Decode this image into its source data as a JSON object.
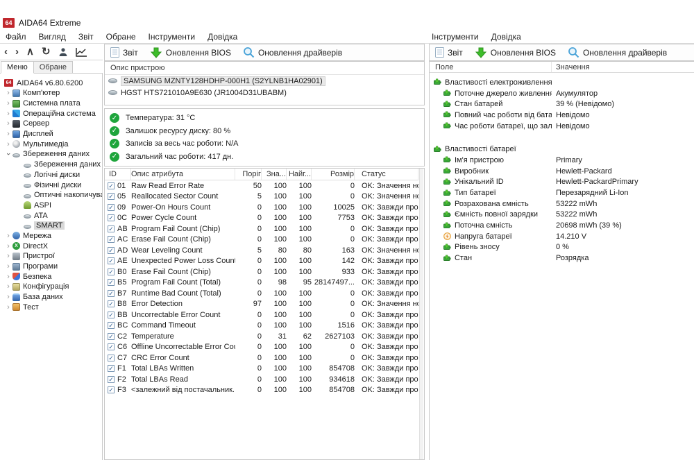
{
  "window": {
    "title": "AIDA64 Extreme",
    "logo": "64"
  },
  "menus": {
    "left": [
      "Файл",
      "Вигляд",
      "Звіт",
      "Обране",
      "Інструменти",
      "Довідка"
    ],
    "right": [
      "Інструменти",
      "Довідка"
    ]
  },
  "nav_icons": [
    "back-arrow",
    "forward-arrow",
    "up-arrow",
    "refresh",
    "user",
    "chart"
  ],
  "toolbar": {
    "report_label": "Звіт",
    "bios_label": "Оновлення BIOS",
    "drivers_label": "Оновлення драйверів"
  },
  "sidebar": {
    "tabs": [
      {
        "label": "Меню",
        "active": true
      },
      {
        "label": "Обране",
        "active": false
      }
    ],
    "root_label": "AIDA64 v6.80.6200",
    "items": [
      {
        "label": "Комп'ютер",
        "icon": "computer",
        "chevron": "collapsed",
        "sub": false,
        "selected": false
      },
      {
        "label": "Системна плата",
        "icon": "motherboard",
        "chevron": "collapsed",
        "sub": false,
        "selected": false
      },
      {
        "label": "Операційна система",
        "icon": "os",
        "chevron": "collapsed",
        "sub": false,
        "selected": false
      },
      {
        "label": "Сервер",
        "icon": "server",
        "chevron": "collapsed",
        "sub": false,
        "selected": false
      },
      {
        "label": "Дисплей",
        "icon": "display",
        "chevron": "collapsed",
        "sub": false,
        "selected": false
      },
      {
        "label": "Мультимедіа",
        "icon": "multimedia",
        "chevron": "collapsed",
        "sub": false,
        "selected": false
      },
      {
        "label": "Збереження даних",
        "icon": "disk",
        "chevron": "expanded",
        "sub": false,
        "selected": false
      },
      {
        "label": "Збереження даних Wi",
        "icon": "disk",
        "chevron": null,
        "sub": true,
        "selected": false
      },
      {
        "label": "Логічні диски",
        "icon": "disk",
        "chevron": null,
        "sub": true,
        "selected": false
      },
      {
        "label": "Фізичні диски",
        "icon": "disk",
        "chevron": null,
        "sub": true,
        "selected": false
      },
      {
        "label": "Оптичні накопичувачі",
        "icon": "disk",
        "chevron": null,
        "sub": true,
        "selected": false
      },
      {
        "label": "ASPI",
        "icon": "aspi",
        "chevron": null,
        "sub": true,
        "selected": false
      },
      {
        "label": "ATA",
        "icon": "disk",
        "chevron": null,
        "sub": true,
        "selected": false
      },
      {
        "label": "SMART",
        "icon": "disk",
        "chevron": null,
        "sub": true,
        "selected": true
      },
      {
        "label": "Мережа",
        "icon": "network",
        "chevron": "collapsed",
        "sub": false,
        "selected": false
      },
      {
        "label": "DirectX",
        "icon": "directx",
        "chevron": "collapsed",
        "sub": false,
        "selected": false
      },
      {
        "label": "Пристрої",
        "icon": "devices",
        "chevron": "collapsed",
        "sub": false,
        "selected": false
      },
      {
        "label": "Програми",
        "icon": "programs",
        "chevron": "collapsed",
        "sub": false,
        "selected": false
      },
      {
        "label": "Безпека",
        "icon": "security",
        "chevron": "collapsed",
        "sub": false,
        "selected": false
      },
      {
        "label": "Конфігурація",
        "icon": "config",
        "chevron": "collapsed",
        "sub": false,
        "selected": false
      },
      {
        "label": "База даних",
        "icon": "database",
        "chevron": "collapsed",
        "sub": false,
        "selected": false
      },
      {
        "label": "Тест",
        "icon": "test",
        "chevron": "collapsed",
        "sub": false,
        "selected": false
      }
    ]
  },
  "devices": {
    "header": "Опис пристрою",
    "rows": [
      {
        "label": "SAMSUNG MZNTY128HDHP-000H1 (S2YLNB1HA02901)",
        "selected": true
      },
      {
        "label": "HGST HTS721010A9E630 (JR1004D31UBABM)",
        "selected": false
      }
    ]
  },
  "status_items": [
    "Температура: 31 °C",
    "Залишок ресурсу диску: 80 %",
    "Записів за весь час роботи: N/A",
    "Загальний час роботи: 417 дн."
  ],
  "smart_table": {
    "columns": [
      "ID",
      "Опис атрибута",
      "Поріг",
      "Зна...",
      "Найг...",
      "Розмір",
      "Статус"
    ],
    "rows": [
      [
        "01",
        "Raw Read Error Rate",
        "50",
        "100",
        "100",
        "0",
        "OK: Значення норм..."
      ],
      [
        "05",
        "Reallocated Sector Count",
        "5",
        "100",
        "100",
        "0",
        "OK: Значення норм..."
      ],
      [
        "09",
        "Power-On Hours Count",
        "0",
        "100",
        "100",
        "10025",
        "OK: Завжди пройде..."
      ],
      [
        "0C",
        "Power Cycle Count",
        "0",
        "100",
        "100",
        "7753",
        "OK: Завжди пройде..."
      ],
      [
        "AB",
        "Program Fail Count (Chip)",
        "0",
        "100",
        "100",
        "0",
        "OK: Завжди пройде..."
      ],
      [
        "AC",
        "Erase Fail Count (Chip)",
        "0",
        "100",
        "100",
        "0",
        "OK: Завжди пройде..."
      ],
      [
        "AD",
        "Wear Leveling Count",
        "5",
        "80",
        "80",
        "163",
        "OK: Значення норм..."
      ],
      [
        "AE",
        "Unexpected Power Loss Count",
        "0",
        "100",
        "100",
        "142",
        "OK: Завжди пройде..."
      ],
      [
        "B0",
        "Erase Fail Count (Chip)",
        "0",
        "100",
        "100",
        "933",
        "OK: Завжди пройде..."
      ],
      [
        "B5",
        "Program Fail Count (Total)",
        "0",
        "98",
        "95",
        "28147497...",
        "OK: Завжди пройде..."
      ],
      [
        "B7",
        "Runtime Bad Count (Total)",
        "0",
        "100",
        "100",
        "0",
        "OK: Завжди пройде..."
      ],
      [
        "B8",
        "Error Detection",
        "97",
        "100",
        "100",
        "0",
        "OK: Значення норм..."
      ],
      [
        "BB",
        "Uncorrectable Error Count",
        "0",
        "100",
        "100",
        "0",
        "OK: Завжди пройде..."
      ],
      [
        "BC",
        "Command Timeout",
        "0",
        "100",
        "100",
        "1516",
        "OK: Завжди пройде..."
      ],
      [
        "C2",
        "Temperature",
        "0",
        "31",
        "62",
        "2627103",
        "OK: Завжди пройде..."
      ],
      [
        "C6",
        "Offline Uncorrectable Error Cou...",
        "0",
        "100",
        "100",
        "0",
        "OK: Завжди пройде..."
      ],
      [
        "C7",
        "CRC Error Count",
        "0",
        "100",
        "100",
        "0",
        "OK: Завжди пройде..."
      ],
      [
        "F1",
        "Total LBAs Written",
        "0",
        "100",
        "100",
        "854708",
        "OK: Завжди пройде..."
      ],
      [
        "F2",
        "Total LBAs Read",
        "0",
        "100",
        "100",
        "934618",
        "OK: Завжди пройде..."
      ],
      [
        "F3",
        "<залежний від постачальник...",
        "0",
        "100",
        "100",
        "854708",
        "OK: Завжди пройде..."
      ]
    ]
  },
  "battery_panel": {
    "columns": {
      "field": "Поле",
      "value": "Значення"
    },
    "sections": [
      {
        "title": "Властивості електроживлення",
        "rows": [
          {
            "field": "Поточне джерело живлення",
            "value": "Акумулятор",
            "icon": "battery"
          },
          {
            "field": "Стан батарей",
            "value": "39 % (Невідомо)",
            "icon": "battery"
          },
          {
            "field": "Повний час роботи від батареї",
            "value": "Невідомо",
            "icon": "battery"
          },
          {
            "field": "Час роботи батареї, що залиш...",
            "value": "Невідомо",
            "icon": "battery"
          }
        ]
      },
      {
        "title": "Властивості батареї",
        "rows": [
          {
            "field": "Ім'я пристрою",
            "value": "Primary",
            "icon": "battery"
          },
          {
            "field": "Виробник",
            "value": "Hewlett-Packard",
            "icon": "battery"
          },
          {
            "field": "Унікальний ID",
            "value": "Hewlett-PackardPrimary",
            "icon": "battery"
          },
          {
            "field": "Тип батареї",
            "value": "Перезарядний Li-Ion",
            "icon": "battery"
          },
          {
            "field": "Розрахована ємність",
            "value": "53222 mWh",
            "icon": "battery"
          },
          {
            "field": "Ємність повної зарядки",
            "value": "53222 mWh",
            "icon": "battery"
          },
          {
            "field": "Поточна ємність",
            "value": "20698 mWh  (39 %)",
            "icon": "battery"
          },
          {
            "field": "Напруга батареї",
            "value": "14.210 V",
            "icon": "voltage"
          },
          {
            "field": "Рівень зносу",
            "value": "0 %",
            "icon": "battery"
          },
          {
            "field": "Стан",
            "value": "Розрядка",
            "icon": "battery"
          }
        ]
      }
    ]
  },
  "colors": {
    "accent_green": "#1ea53c",
    "arrow_green": "#3dbd2a",
    "magnifier_blue": "#4aa3d8",
    "logo_red": "#c0272d",
    "voltage_orange": "#e8a33d"
  }
}
